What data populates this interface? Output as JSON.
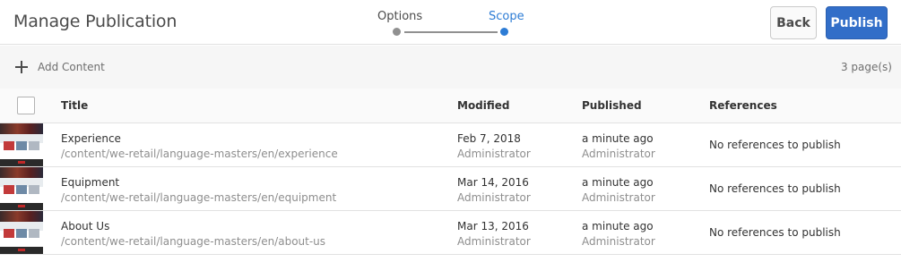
{
  "header": {
    "title": "Manage Publication",
    "wizard": {
      "steps": [
        "Options",
        "Scope"
      ],
      "active_step": "Scope"
    },
    "back_label": "Back",
    "publish_label": "Publish"
  },
  "toolbar": {
    "add_content_label": "Add Content",
    "page_count": "3 page(s)"
  },
  "table": {
    "columns": [
      "Title",
      "Modified",
      "Published",
      "References"
    ],
    "rows": [
      {
        "title": "Experience",
        "path": "/content/we-retail/language-masters/en/experience",
        "modified_date": "Feb 7, 2018",
        "modified_by": "Administrator",
        "published_date": "a minute ago",
        "published_by": "Administrator",
        "references": "No references to publish"
      },
      {
        "title": "Equipment",
        "path": "/content/we-retail/language-masters/en/equipment",
        "modified_date": "Mar 14, 2016",
        "modified_by": "Administrator",
        "published_date": "a minute ago",
        "published_by": "Administrator",
        "references": "No references to publish"
      },
      {
        "title": "About Us",
        "path": "/content/we-retail/language-masters/en/about-us",
        "modified_date": "Mar 13, 2016",
        "modified_by": "Administrator",
        "published_date": "a minute ago",
        "published_by": "Administrator",
        "references": "No references to publish"
      }
    ]
  },
  "colors": {
    "accent": "#326ec8",
    "active_step": "#2d7cd5",
    "inactive_step": "#909090"
  }
}
